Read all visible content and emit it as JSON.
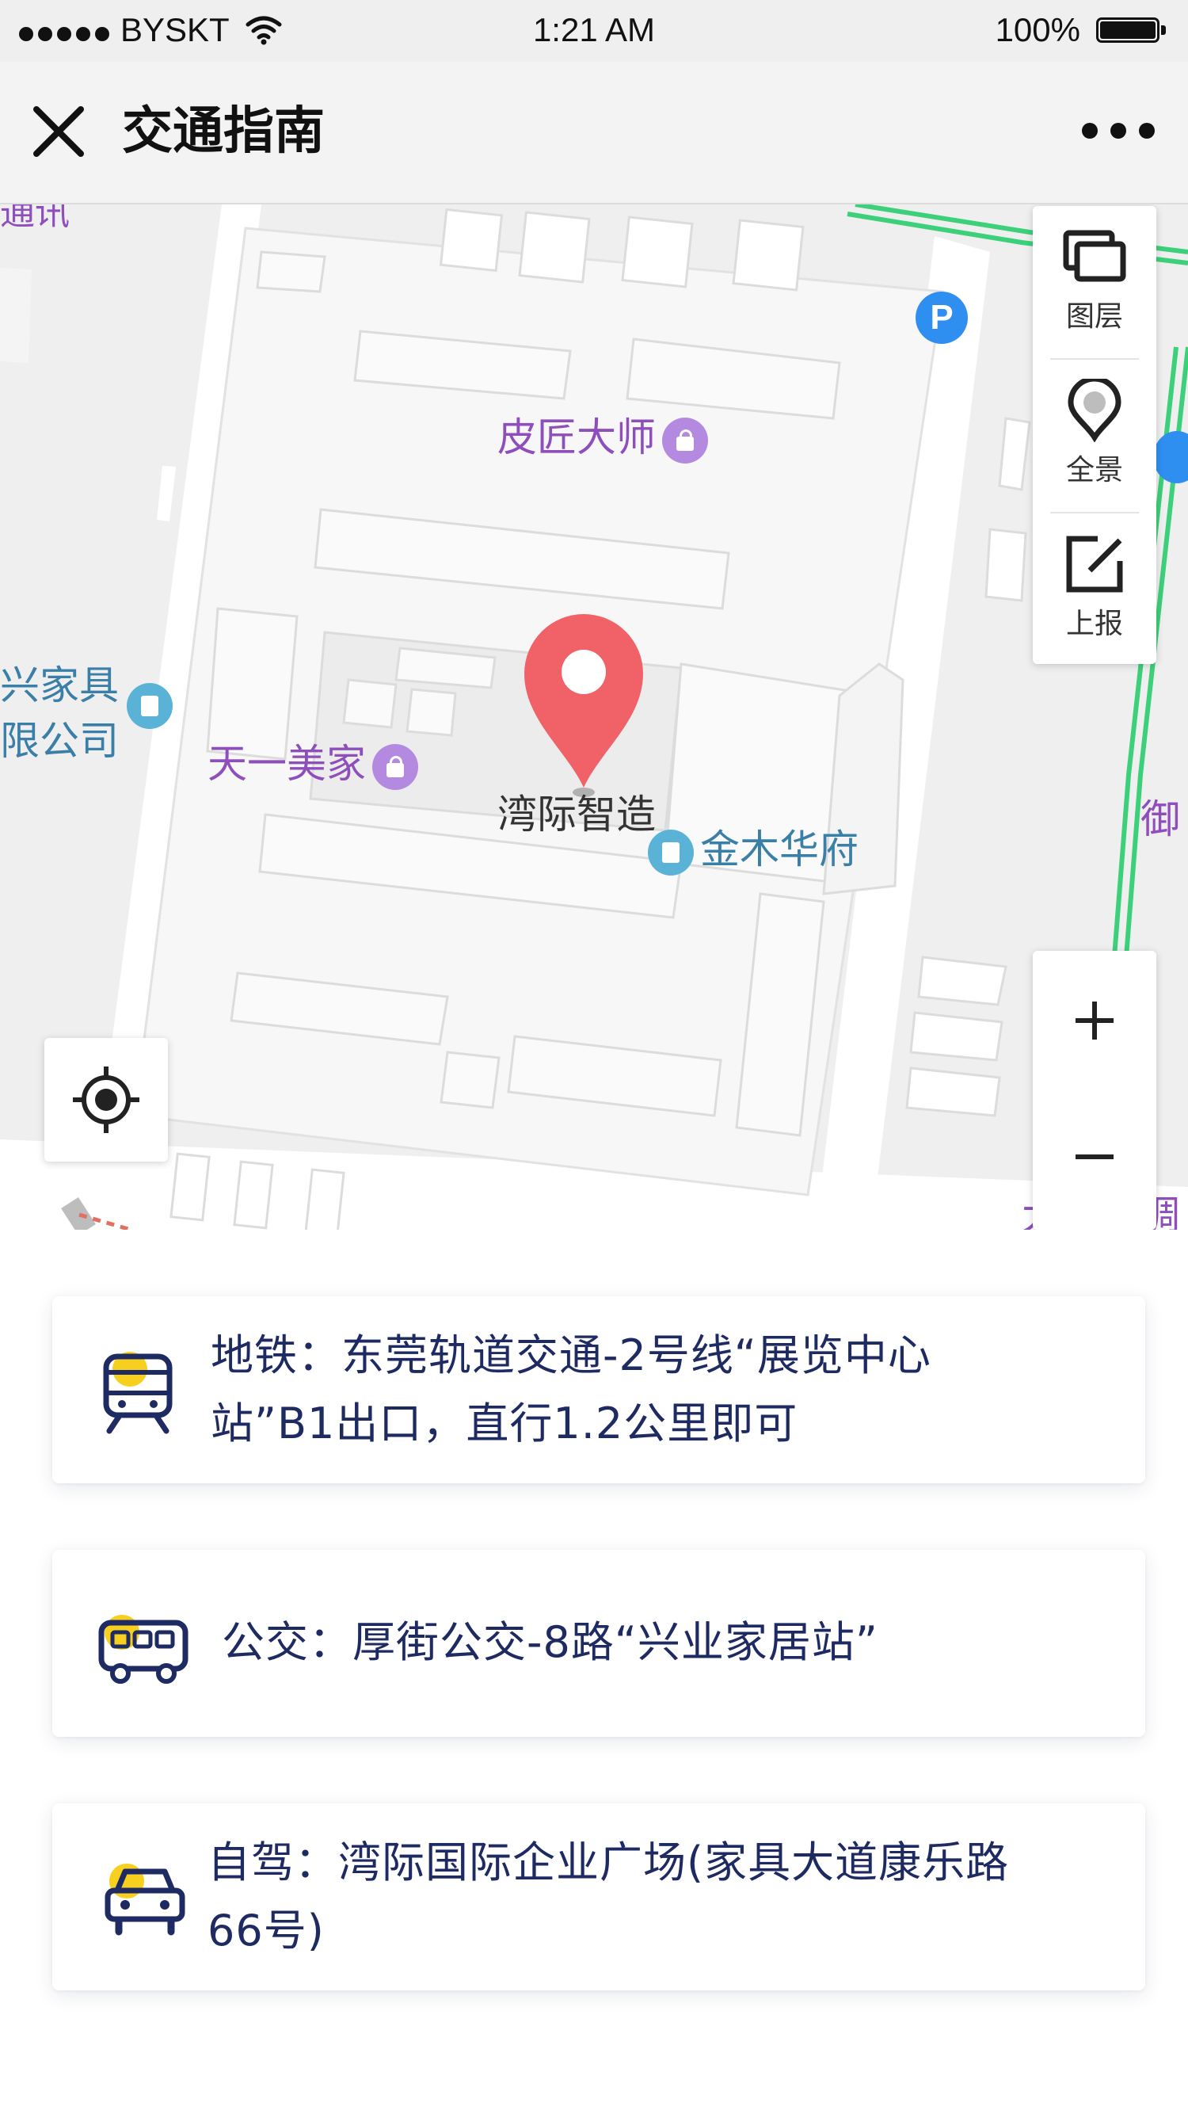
{
  "status_bar": {
    "carrier": "BYSKT",
    "time": "1:21 AM",
    "battery": "100%"
  },
  "nav": {
    "title": "交通指南",
    "close_icon": "close-icon",
    "more_icon": "more-dots-icon"
  },
  "map": {
    "poi_labels": {
      "top_left_fragment": "通讯",
      "pijiang": "皮匠大师",
      "jinmu": "金木华府",
      "xingjiaju_line1": "兴家具",
      "xingjiaju_line2": "限公司",
      "tianyi": "天一美家",
      "yu_fragment": "御",
      "bottom_fragment": "大金空调",
      "destination": "湾际智造"
    },
    "parking_label": "P",
    "tools": [
      {
        "label": "图层",
        "icon": "layers-icon"
      },
      {
        "label": "全景",
        "icon": "panorama-pin-icon"
      },
      {
        "label": "上报",
        "icon": "report-edit-icon"
      }
    ],
    "zoom_in_icon": "plus-icon",
    "zoom_out_icon": "minus-icon",
    "locate_icon": "locate-icon",
    "colors": {
      "pin": "#f06268",
      "road_green": "#3dd07a",
      "poi_purple": "#8e4fbd"
    }
  },
  "transport": [
    {
      "icon": "subway-icon",
      "line1": "地铁：东莞轨道交通-2号线“展览中心",
      "line2": "站”B1出口，直行1.2公里即可"
    },
    {
      "icon": "bus-icon",
      "line1": "公交：厚街公交-8路“兴业家居站”",
      "line2": ""
    },
    {
      "icon": "car-icon",
      "line1": "自驾：湾际国际企业广场(家具大道康乐路",
      "line2": "66号)"
    }
  ],
  "accent_colors": {
    "text": "#1e2a62",
    "icon_yellow": "#f7cf1e"
  }
}
